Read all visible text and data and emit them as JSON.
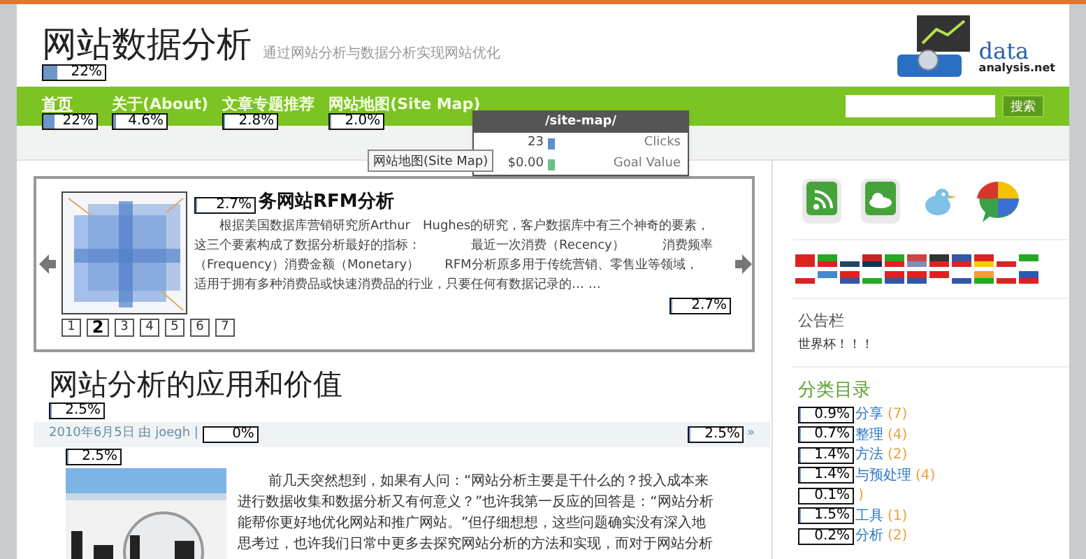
{
  "header": {
    "title": "网站数据分析",
    "title_overlay": {
      "text": "22%",
      "level": 0.22
    },
    "tagline": "通过网站分析与数据分析实现网站优化",
    "logo": {
      "line1": "data",
      "line2": "analysis.net"
    }
  },
  "nav": {
    "items": [
      {
        "label": "首页",
        "selected": true,
        "overlay": {
          "text": "22%",
          "level": 0.22
        }
      },
      {
        "label": "关于(About)",
        "selected": false,
        "overlay": {
          "text": "4.6%",
          "level": 0.046
        }
      },
      {
        "label": "文章专题推荐",
        "selected": false,
        "overlay": {
          "text": "2.8%",
          "level": 0.028
        }
      },
      {
        "label": "网站地图(Site Map)",
        "selected": false,
        "overlay": {
          "text": "2.0%",
          "level": 0.02
        }
      }
    ],
    "search_button": "搜索"
  },
  "tooltip": "网站地图(Site Map)",
  "popup": {
    "title": "/site-map/",
    "rows": [
      {
        "value": "23",
        "label": "Clicks",
        "color": "#5b8fd0"
      },
      {
        "value": "$0.00",
        "label": "Goal Value",
        "color": "#6cc08a"
      }
    ]
  },
  "slider": {
    "title_overlay": {
      "text": "2.7%",
      "level": 0.027
    },
    "title": "务网站RFM分析",
    "lines": [
      "根据美国数据库营销研究所Arthur　Hughes的研究，客户数据库中有三个神奇的要素，",
      "这三个要素构成了数据分析最好的指标：　　　　最近一次消费（Recency）　　　消费频率",
      "（Frequency）消费金额（Monetary）　　RFM分析原多用于传统营销、零售业等领域，",
      "适用于拥有多种消费品或快速消费品的行业，只要任何有数据记录的… …"
    ],
    "more_overlay": {
      "text": "2.7%",
      "level": 0.027
    },
    "pages": [
      {
        "label": "1",
        "selected": false
      },
      {
        "label": "2",
        "selected": true
      },
      {
        "label": "3",
        "selected": false
      },
      {
        "label": "4",
        "selected": false
      },
      {
        "label": "5",
        "selected": false
      },
      {
        "label": "6",
        "selected": false
      },
      {
        "label": "7",
        "selected": false
      }
    ]
  },
  "article": {
    "title": "网站分析的应用和价值",
    "title_overlay": {
      "text": "2.5%",
      "level": 0.025
    },
    "meta": "2010年6月5日 由 joegh |",
    "meta_overlay": {
      "text": "0%",
      "level": 0
    },
    "comments_overlay": {
      "text": "2.5%",
      "level": 0.025
    },
    "comments_arrow": "»",
    "image_overlay": {
      "text": "2.5%",
      "level": 0.025
    },
    "lines": [
      "前几天突然想到，如果有人问：“网站分析主要是干什么的？投入成本来",
      "进行数据收集和数据分析又有何意义？”也许我第一反应的回答是：“网站分析",
      "能帮你更好地优化网站和推广网站。”但仔细想想，这些问题确实没有深入地",
      "思考过，也许我们日常中更多去探究网站分析的方法和实现，而对于网站分析"
    ]
  },
  "sidebar": {
    "notice_title": "公告栏",
    "notice_text": "世界杯！！！",
    "categories_title": "分类目录",
    "categories": [
      {
        "label": "分享",
        "count": "(7)",
        "overlay": {
          "text": "0.9%",
          "level": 0.009
        }
      },
      {
        "label": "整理",
        "count": "(4)",
        "overlay": {
          "text": "0.7%",
          "level": 0.007
        }
      },
      {
        "label": "方法",
        "count": "(2)",
        "overlay": {
          "text": "1.4%",
          "level": 0.014
        }
      },
      {
        "label": "与预处理",
        "count": "(4)",
        "overlay": {
          "text": "1.4%",
          "level": 0.014
        }
      },
      {
        "count": ")",
        "overlay": {
          "text": "0.1%",
          "level": 0.001
        }
      },
      {
        "label": "工具",
        "count": "(1)",
        "overlay": {
          "text": "1.5%",
          "level": 0.015
        }
      },
      {
        "label": "分析",
        "count": "(2)",
        "overlay": {
          "text": "0.2%",
          "level": 0.002
        }
      }
    ]
  }
}
